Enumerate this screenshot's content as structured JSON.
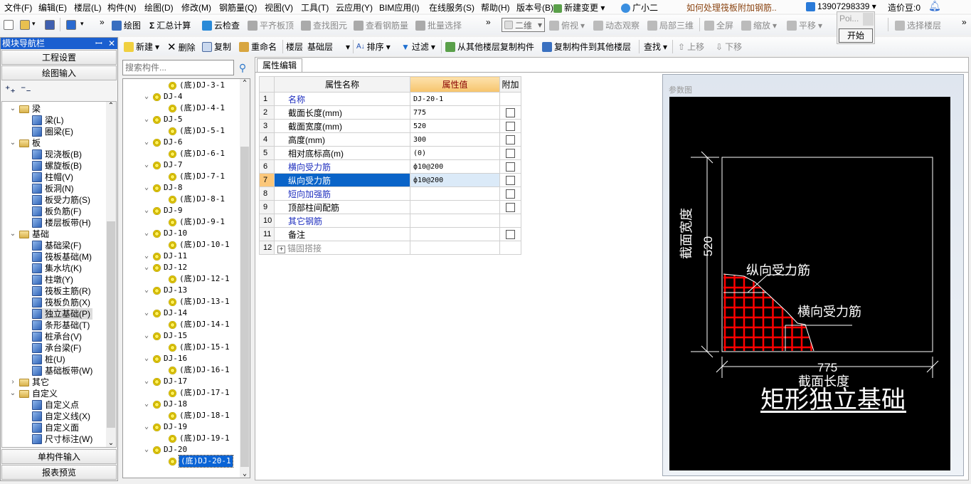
{
  "menu": [
    "文件(F)",
    "编辑(E)",
    "楼层(L)",
    "构件(N)",
    "绘图(D)",
    "修改(M)",
    "钢筋量(Q)",
    "视图(V)",
    "工具(T)",
    "云应用(Y)",
    "BIM应用(I)",
    "在线服务(S)",
    "帮助(H)",
    "版本号(B)"
  ],
  "menu_right": {
    "new_change": "新建变更",
    "assistant": "广小二",
    "question": "如何处理筏板附加钢筋..",
    "account": "13907298339",
    "beans": "造价豆:0",
    "question_color": "#8b4513"
  },
  "toolbar1": {
    "overflow": "»",
    "items": [
      {
        "label": "绘图",
        "icon": "draw-icon",
        "enabled": true
      },
      {
        "label": "汇总计算",
        "icon": "sigma-icon",
        "enabled": true
      },
      {
        "label": "云检查",
        "icon": "cloud-check-icon",
        "enabled": true
      },
      {
        "label": "平齐板顶",
        "icon": "align-slab-icon",
        "enabled": false
      },
      {
        "label": "查找图元",
        "icon": "binoculars-icon",
        "enabled": false
      },
      {
        "label": "查看钢筋量",
        "icon": "rebar-view-icon",
        "enabled": false
      },
      {
        "label": "批量选择",
        "icon": "batch-select-icon",
        "enabled": false
      }
    ],
    "view_mode": "二维",
    "view_items": [
      {
        "label": "俯视",
        "dropdown": true
      },
      {
        "label": "动态观察",
        "dropdown": false
      },
      {
        "label": "局部三维",
        "dropdown": false
      },
      {
        "label": "全屏",
        "dropdown": false
      },
      {
        "label": "缩放",
        "dropdown": true
      },
      {
        "label": "平移",
        "dropdown": true
      },
      {
        "label": "选择楼层",
        "dropdown": false
      }
    ]
  },
  "popup": {
    "title": "Poi...",
    "button": "开始"
  },
  "nav": {
    "title": "模块导航栏",
    "top_buttons": [
      "工程设置",
      "绘图输入"
    ],
    "bottom_buttons": [
      "单构件输入",
      "报表预览"
    ],
    "tree": [
      {
        "label": "梁",
        "expanded": true,
        "children": [
          "梁(L)",
          "圈梁(E)"
        ]
      },
      {
        "label": "板",
        "expanded": true,
        "children": [
          "现浇板(B)",
          "螺旋板(B)",
          "柱帽(V)",
          "板洞(N)",
          "板受力筋(S)",
          "板负筋(F)",
          "楼层板带(H)"
        ]
      },
      {
        "label": "基础",
        "expanded": true,
        "children": [
          "基础梁(F)",
          "筏板基础(M)",
          "集水坑(K)",
          "柱墩(Y)",
          "筏板主筋(R)",
          "筏板负筋(X)",
          "独立基础(P)",
          "条形基础(T)",
          "桩承台(V)",
          "承台梁(F)",
          "桩(U)",
          "基础板带(W)"
        ]
      },
      {
        "label": "其它",
        "expanded": false,
        "children": []
      },
      {
        "label": "自定义",
        "expanded": true,
        "children": [
          "自定义点",
          "自定义线(X)",
          "自定义面",
          "尺寸标注(W)"
        ]
      }
    ],
    "selected": "独立基础(P)"
  },
  "toolbar2": {
    "new": "新建",
    "delete": "删除",
    "copy": "复制",
    "rename": "重命名",
    "floor_label": "楼层",
    "floor_value": "基础层",
    "sort": "排序",
    "filter": "过滤",
    "copy_from": "从其他楼层复制构件",
    "copy_to": "复制构件到其他楼层",
    "find": "查找",
    "move_up": "上移",
    "move_down": "下移"
  },
  "component_tree": {
    "search_placeholder": "搜索构件...",
    "items": [
      {
        "label": "(底)DJ-3-1",
        "level": 1
      },
      {
        "label": "DJ-4",
        "level": 0
      },
      {
        "label": "(底)DJ-4-1",
        "level": 1
      },
      {
        "label": "DJ-5",
        "level": 0
      },
      {
        "label": "(底)DJ-5-1",
        "level": 1
      },
      {
        "label": "DJ-6",
        "level": 0
      },
      {
        "label": "(底)DJ-6-1",
        "level": 1
      },
      {
        "label": "DJ-7",
        "level": 0
      },
      {
        "label": "(底)DJ-7-1",
        "level": 1
      },
      {
        "label": "DJ-8",
        "level": 0
      },
      {
        "label": "(底)DJ-8-1",
        "level": 1
      },
      {
        "label": "DJ-9",
        "level": 0
      },
      {
        "label": "(底)DJ-9-1",
        "level": 1
      },
      {
        "label": "DJ-10",
        "level": 0
      },
      {
        "label": "(底)DJ-10-1",
        "level": 1
      },
      {
        "label": "DJ-11",
        "level": 0
      },
      {
        "label": "DJ-12",
        "level": 0
      },
      {
        "label": "(底)DJ-12-1",
        "level": 1
      },
      {
        "label": "DJ-13",
        "level": 0
      },
      {
        "label": "(底)DJ-13-1",
        "level": 1
      },
      {
        "label": "DJ-14",
        "level": 0
      },
      {
        "label": "(底)DJ-14-1",
        "level": 1
      },
      {
        "label": "DJ-15",
        "level": 0
      },
      {
        "label": "(底)DJ-15-1",
        "level": 1
      },
      {
        "label": "DJ-16",
        "level": 0
      },
      {
        "label": "(底)DJ-16-1",
        "level": 1
      },
      {
        "label": "DJ-17",
        "level": 0
      },
      {
        "label": "(底)DJ-17-1",
        "level": 1
      },
      {
        "label": "DJ-18",
        "level": 0
      },
      {
        "label": "(底)DJ-18-1",
        "level": 1
      },
      {
        "label": "DJ-19",
        "level": 0
      },
      {
        "label": "(底)DJ-19-1",
        "level": 1
      },
      {
        "label": "DJ-20",
        "level": 0
      },
      {
        "label": "(底)DJ-20-1",
        "level": 1
      }
    ],
    "selected": "(底)DJ-20-1"
  },
  "properties": {
    "tab": "属性编辑",
    "headers": [
      "属性名称",
      "属性值",
      "附加"
    ],
    "rows": [
      {
        "n": "1",
        "name": "名称",
        "value": "DJ-20-1",
        "style": "blue",
        "checkbox": false
      },
      {
        "n": "2",
        "name": "截面长度(mm)",
        "value": "775",
        "style": "",
        "checkbox": true
      },
      {
        "n": "3",
        "name": "截面宽度(mm)",
        "value": "520",
        "style": "",
        "checkbox": true
      },
      {
        "n": "4",
        "name": "高度(mm)",
        "value": "300",
        "style": "",
        "checkbox": true
      },
      {
        "n": "5",
        "name": "相对底标高(m)",
        "value": "(0)",
        "style": "",
        "checkbox": true
      },
      {
        "n": "6",
        "name": "横向受力筋",
        "value": "ф10@200",
        "style": "blue",
        "checkbox": true
      },
      {
        "n": "7",
        "name": "纵向受力筋",
        "value": "ф10@200",
        "style": "blue",
        "checkbox": true,
        "selected": true
      },
      {
        "n": "8",
        "name": "短向加强筋",
        "value": "",
        "style": "blue",
        "checkbox": true
      },
      {
        "n": "9",
        "name": "顶部柱间配筋",
        "value": "",
        "style": "",
        "checkbox": true
      },
      {
        "n": "10",
        "name": "其它钢筋",
        "value": "",
        "style": "blue",
        "checkbox": false
      },
      {
        "n": "11",
        "name": "备注",
        "value": "",
        "style": "",
        "checkbox": true
      },
      {
        "n": "12",
        "name": "锚固搭接",
        "value": "",
        "style": "gray",
        "checkbox": false,
        "expandable": true
      }
    ]
  },
  "diagram": {
    "title": "参数图",
    "width_label": "截面宽度",
    "width_value": "520",
    "length_label": "截面长度",
    "length_value": "775",
    "long_bar": "纵向受力筋",
    "trans_bar": "横向受力筋",
    "caption": "矩形独立基础",
    "rebar_color": "#ff0000"
  }
}
